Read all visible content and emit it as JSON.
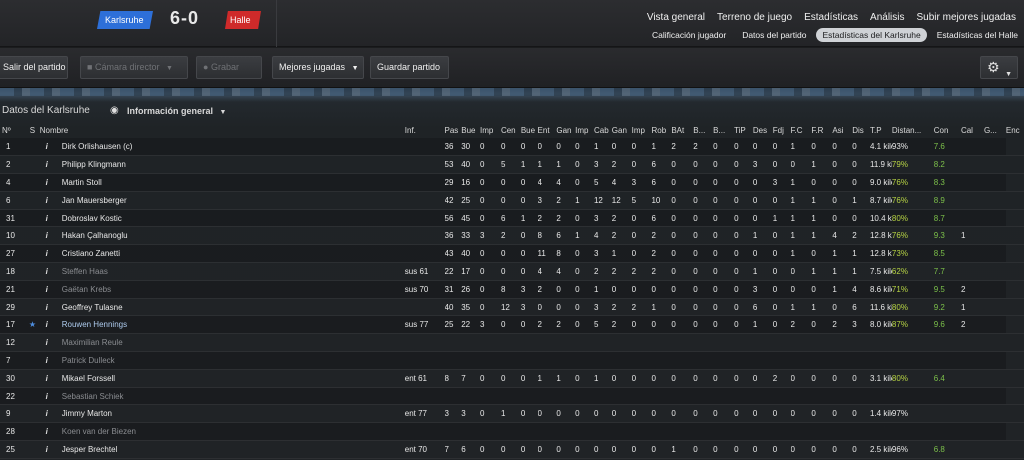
{
  "header": {
    "home_team": "Karlsruhe",
    "score": "6-0",
    "away_team": "Halle",
    "main_nav": [
      "Vista general",
      "Terreno de juego",
      "Estadísticas",
      "Análisis",
      "Subir mejores jugadas"
    ],
    "sub_nav": [
      "Calificación jugador",
      "Datos del partido",
      "Estadísticas del Karlsruhe",
      "Estadísticas del Halle"
    ],
    "active_sub_nav": "Estadísticas del Karlsruhe"
  },
  "toolbar": {
    "exit_label": "Salir del partido",
    "camera_label": "Cámara director",
    "record_label": "Grabar",
    "highlights_label": "Mejores jugadas",
    "save_label": "Guardar partido"
  },
  "data_header": {
    "title": "Datos del Karlsruhe",
    "view_label": "Información general"
  },
  "columns": [
    "Nº",
    "S",
    "Nombre",
    "Inf.",
    "Pas",
    "Bue",
    "Imp",
    "Cen",
    "Bue",
    "Ent",
    "Gan",
    "Imp",
    "Cab",
    "Gan",
    "Imp",
    "Rob",
    "BAt",
    "B...",
    "B...",
    "TiP",
    "Des",
    "Fdj",
    "F.C",
    "F.R",
    "Asi",
    "Dis",
    "T.P",
    "Distan...",
    "Con",
    "Cal",
    "G...",
    "Enc"
  ],
  "rows": [
    {
      "num": "1",
      "star": false,
      "name": "Dirk Orlishausen (c)",
      "info": "",
      "style": "",
      "vals": [
        "36",
        "30",
        "0",
        "0",
        "0",
        "0",
        "0",
        "0",
        "1",
        "0",
        "0",
        "1",
        "2",
        "2",
        "0",
        "0",
        "0",
        "0",
        "1",
        "0",
        "0",
        "0"
      ],
      "dist": "4.1 kiló...",
      "con": "93%",
      "cal": "7.6",
      "g": "",
      "enc": ""
    },
    {
      "num": "2",
      "star": false,
      "name": "Philipp Klingmann",
      "info": "",
      "style": "",
      "vals": [
        "53",
        "40",
        "0",
        "5",
        "1",
        "1",
        "1",
        "0",
        "3",
        "2",
        "0",
        "6",
        "0",
        "0",
        "0",
        "0",
        "3",
        "0",
        "0",
        "1",
        "0",
        "0"
      ],
      "dist": "11.9 kil...",
      "con": "79%",
      "cal": "8.2",
      "g": "",
      "enc": ""
    },
    {
      "num": "4",
      "star": false,
      "name": "Martin Stoll",
      "info": "",
      "style": "",
      "vals": [
        "29",
        "16",
        "0",
        "0",
        "0",
        "4",
        "4",
        "0",
        "5",
        "4",
        "3",
        "6",
        "0",
        "0",
        "0",
        "0",
        "0",
        "3",
        "1",
        "0",
        "0",
        "0"
      ],
      "dist": "9.0 kiló...",
      "con": "76%",
      "cal": "8.3",
      "g": "",
      "enc": ""
    },
    {
      "num": "6",
      "star": false,
      "name": "Jan Mauersberger",
      "info": "",
      "style": "",
      "vals": [
        "42",
        "25",
        "0",
        "0",
        "0",
        "3",
        "2",
        "1",
        "12",
        "12",
        "5",
        "10",
        "0",
        "0",
        "0",
        "0",
        "0",
        "0",
        "1",
        "1",
        "0",
        "1"
      ],
      "dist": "8.7 kiló...",
      "con": "76%",
      "cal": "8.9",
      "g": "",
      "enc": ""
    },
    {
      "num": "31",
      "star": false,
      "name": "Dobroslav Kostic",
      "info": "",
      "style": "",
      "vals": [
        "56",
        "45",
        "0",
        "6",
        "1",
        "2",
        "2",
        "0",
        "3",
        "2",
        "0",
        "6",
        "0",
        "0",
        "0",
        "0",
        "0",
        "1",
        "1",
        "1",
        "0",
        "0"
      ],
      "dist": "10.4 kil...",
      "con": "80%",
      "cal": "8.7",
      "g": "",
      "enc": ""
    },
    {
      "num": "10",
      "star": false,
      "name": "Hakan Çalhanoglu",
      "info": "",
      "style": "",
      "vals": [
        "36",
        "33",
        "3",
        "2",
        "0",
        "8",
        "6",
        "1",
        "4",
        "2",
        "0",
        "2",
        "0",
        "0",
        "0",
        "0",
        "1",
        "0",
        "1",
        "1",
        "4",
        "2"
      ],
      "dist": "12.8 kil...",
      "con": "76%",
      "cal": "9.3",
      "g": "1",
      "enc": ""
    },
    {
      "num": "27",
      "star": false,
      "name": "Cristiano Zanetti",
      "info": "",
      "style": "",
      "vals": [
        "43",
        "40",
        "0",
        "0",
        "0",
        "11",
        "8",
        "0",
        "3",
        "1",
        "0",
        "2",
        "0",
        "0",
        "0",
        "0",
        "0",
        "0",
        "1",
        "0",
        "1",
        "1"
      ],
      "dist": "12.8 kil...",
      "con": "73%",
      "cal": "8.5",
      "g": "",
      "enc": ""
    },
    {
      "num": "18",
      "star": false,
      "name": "Steffen Haas",
      "info": "sus 61",
      "style": "sub",
      "vals": [
        "22",
        "17",
        "0",
        "0",
        "0",
        "4",
        "4",
        "0",
        "2",
        "2",
        "2",
        "2",
        "0",
        "0",
        "0",
        "0",
        "1",
        "0",
        "0",
        "1",
        "1",
        "1"
      ],
      "dist": "7.5 kiló...",
      "con": "62%",
      "cal": "7.7",
      "g": "",
      "enc": ""
    },
    {
      "num": "21",
      "star": false,
      "name": "Gaëtan Krebs",
      "info": "sus 70",
      "style": "sub",
      "vals": [
        "31",
        "26",
        "0",
        "8",
        "3",
        "2",
        "0",
        "0",
        "1",
        "0",
        "0",
        "0",
        "0",
        "0",
        "0",
        "0",
        "3",
        "0",
        "0",
        "0",
        "1",
        "4"
      ],
      "dist": "8.6 kiló...",
      "con": "71%",
      "cal": "9.5",
      "g": "2",
      "enc": ""
    },
    {
      "num": "29",
      "star": false,
      "name": "Geoffrey Tulasne",
      "info": "",
      "style": "",
      "vals": [
        "40",
        "35",
        "0",
        "12",
        "3",
        "0",
        "0",
        "0",
        "3",
        "2",
        "2",
        "1",
        "0",
        "0",
        "0",
        "0",
        "6",
        "0",
        "1",
        "1",
        "0",
        "6"
      ],
      "dist": "11.6 kil...",
      "con": "80%",
      "cal": "9.2",
      "g": "1",
      "enc": ""
    },
    {
      "num": "17",
      "star": true,
      "name": "Rouwen Hennings",
      "info": "sus 77",
      "style": "hl",
      "vals": [
        "25",
        "22",
        "3",
        "0",
        "0",
        "2",
        "2",
        "0",
        "5",
        "2",
        "0",
        "0",
        "0",
        "0",
        "0",
        "0",
        "1",
        "0",
        "2",
        "0",
        "2",
        "3"
      ],
      "dist": "8.0 kiló...",
      "con": "87%",
      "cal": "9.6",
      "g": "2",
      "enc": ""
    },
    {
      "num": "12",
      "star": false,
      "name": "Maximilian Reule",
      "info": "",
      "style": "sub",
      "vals": [],
      "dist": "",
      "con": "",
      "cal": "",
      "g": "",
      "enc": ""
    },
    {
      "num": "7",
      "star": false,
      "name": "Patrick Dulleck",
      "info": "",
      "style": "sub",
      "vals": [],
      "dist": "",
      "con": "",
      "cal": "",
      "g": "",
      "enc": ""
    },
    {
      "num": "30",
      "star": false,
      "name": "Mikael Forssell",
      "info": "ent 61",
      "style": "",
      "vals": [
        "8",
        "7",
        "0",
        "0",
        "0",
        "1",
        "1",
        "0",
        "1",
        "0",
        "0",
        "0",
        "0",
        "0",
        "0",
        "0",
        "0",
        "2",
        "0",
        "0",
        "0",
        "0"
      ],
      "dist": "3.1 kiló...",
      "con": "80%",
      "cal": "6.4",
      "g": "",
      "enc": ""
    },
    {
      "num": "22",
      "star": false,
      "name": "Sebastian Schiek",
      "info": "",
      "style": "sub",
      "vals": [],
      "dist": "",
      "con": "",
      "cal": "",
      "g": "",
      "enc": ""
    },
    {
      "num": "9",
      "star": false,
      "name": "Jimmy Marton",
      "info": "ent 77",
      "style": "",
      "vals": [
        "3",
        "3",
        "0",
        "1",
        "0",
        "0",
        "0",
        "0",
        "0",
        "0",
        "0",
        "0",
        "0",
        "0",
        "0",
        "0",
        "0",
        "0",
        "0",
        "0",
        "0",
        "0"
      ],
      "dist": "1.4 kiló...",
      "con": "97%",
      "cal": "",
      "g": "",
      "enc": ""
    },
    {
      "num": "28",
      "star": false,
      "name": "Koen van der Biezen",
      "info": "",
      "style": "sub",
      "vals": [],
      "dist": "",
      "con": "",
      "cal": "",
      "g": "",
      "enc": ""
    },
    {
      "num": "25",
      "star": false,
      "name": "Jesper Brechtel",
      "info": "ent 70",
      "style": "",
      "vals": [
        "7",
        "6",
        "0",
        "0",
        "0",
        "0",
        "0",
        "0",
        "0",
        "0",
        "0",
        "0",
        "1",
        "0",
        "0",
        "0",
        "0",
        "0",
        "0",
        "0",
        "0",
        "0"
      ],
      "dist": "2.5 kiló...",
      "con": "96%",
      "cal": "6.8",
      "g": "",
      "enc": ""
    }
  ]
}
